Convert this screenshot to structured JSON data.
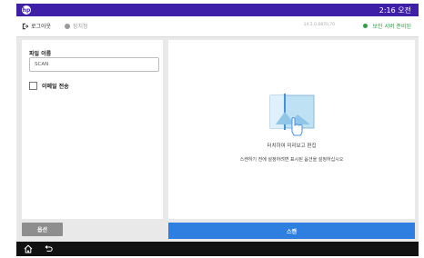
{
  "topbar": {
    "logo_text": "hp",
    "time": "2:16 오전"
  },
  "subbar": {
    "logout_label": "로그아웃",
    "status_label": "장치정",
    "ip_address": "14.2.0.6870.70",
    "secure_label": "보안 서버 준비된"
  },
  "left_panel": {
    "file_name_label": "파일 이름",
    "file_name_value": "SCAN",
    "email_checkbox_label": "이메일 전송"
  },
  "preview": {
    "title": "터치하여 미리보고 편집",
    "description": "스캔하기 전에 설정하려면 표시된 옵션을 설정하십시오"
  },
  "buttons": {
    "options": "옵션",
    "scan": "스캔"
  },
  "colors": {
    "topbar": "#3d1fa8",
    "scan_button": "#2f7fe0",
    "secure": "#2f9e44"
  },
  "icons": [
    "hp-logo-icon",
    "logout-icon",
    "status-dot-icon",
    "secure-dot-icon",
    "scan-preview-icon",
    "home-icon",
    "back-icon"
  ]
}
